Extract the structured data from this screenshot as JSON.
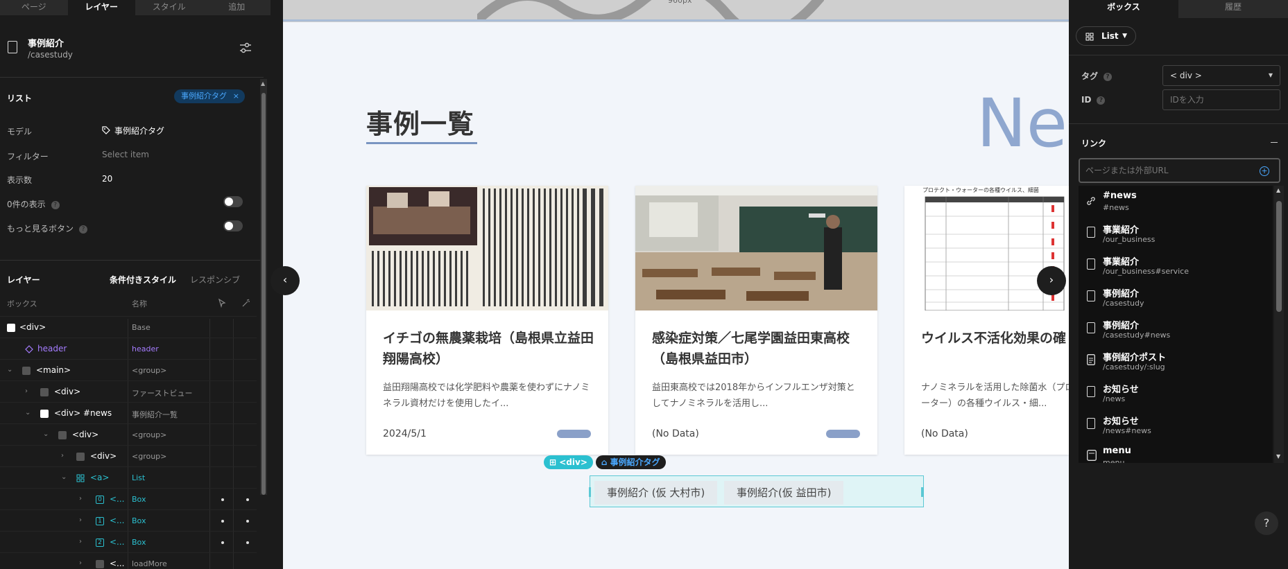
{
  "left": {
    "tabs": [
      "ページ",
      "レイヤー",
      "スタイル",
      "追加"
    ],
    "page": {
      "title": "事例紹介",
      "path": "/casestudy"
    },
    "list": {
      "title": "リスト",
      "chip": "事例紹介タグ",
      "props": {
        "model_label": "モデル",
        "model_value": "事例紹介タグ",
        "filter_label": "フィルター",
        "filter_value": "Select item",
        "count_label": "表示数",
        "count_value": "20",
        "zero_label": "0件の表示",
        "more_label": "もっと見るボタン"
      }
    },
    "layers": {
      "tabs": [
        "レイヤー",
        "条件付きスタイル",
        "レスポンシブ"
      ],
      "col_box": "ボックス",
      "col_name": "名称",
      "rows": [
        {
          "label": "<div>",
          "name": "Base"
        },
        {
          "label": "header",
          "name": "header"
        },
        {
          "label": "<main>",
          "name": "<group>"
        },
        {
          "label": "<div>",
          "name": "ファーストビュー"
        },
        {
          "label": "<div> #news",
          "name": "事例紹介一覧"
        },
        {
          "label": "<div>",
          "name": "<group>"
        },
        {
          "label": "<div>",
          "name": "<group>"
        },
        {
          "label": "<a>",
          "name": "List"
        },
        {
          "label": "<...",
          "name": "Box",
          "idx": "0"
        },
        {
          "label": "<...",
          "name": "Box",
          "idx": "1"
        },
        {
          "label": "<...",
          "name": "Box",
          "idx": "2"
        },
        {
          "label": "<...",
          "name": "loadMore"
        }
      ]
    }
  },
  "canvas": {
    "ruler_label": "960px",
    "section_title": "事例一覧",
    "big_word": "New",
    "cards": [
      {
        "title": "イチゴの無農薬栽培（島根県立益田翔陽高校）",
        "desc": "益田翔陽高校では化学肥料や農薬を使わずにナノミネラル資材だけを使用したイ...",
        "date": "2024/5/1"
      },
      {
        "title": "感染症対策／七尾学園益田東高校（島根県益田市）",
        "desc": "益田東高校では2018年からインフルエンザ対策としてナノミネラルを活用し...",
        "date": "(No Data)"
      },
      {
        "title": "ウイルス不活化効果の確",
        "desc": "ナノミネラルを活用した除菌水（プロ\nーター）の各種ウイルス・細...",
        "date": "(No Data)",
        "img_caption": "プロテクト・ウォーターの各種ウイルス、細菌"
      }
    ],
    "prev_arrow": "‹",
    "next_arrow": "›",
    "sel_tags": [
      "<div>",
      "事例紹介タグ"
    ],
    "sel_items": [
      "事例紹介 (仮 大村市)",
      "事例紹介(仮 益田市)"
    ]
  },
  "right": {
    "tabs": [
      "ボックス",
      "履歴"
    ],
    "list_button": "List",
    "tag_label": "タグ",
    "tag_value": "< div >",
    "id_label": "ID",
    "id_placeholder": "IDを入力",
    "link_title": "リンク",
    "url_placeholder": "ページまたは外部URL",
    "items": [
      {
        "title": "#news",
        "path": "#news",
        "icon": "link-icon"
      },
      {
        "title": "事業紹介",
        "path": "/our_business",
        "icon": "page-icon"
      },
      {
        "title": "事業紹介",
        "path": "/our_business#service",
        "icon": "page-icon"
      },
      {
        "title": "事例紹介",
        "path": "/casestudy",
        "icon": "page-icon"
      },
      {
        "title": "事例紹介",
        "path": "/casestudy#news",
        "icon": "page-icon"
      },
      {
        "title": "事例紹介ポスト",
        "path": "/casestudy/:slug",
        "icon": "doc-icon"
      },
      {
        "title": "お知らせ",
        "path": "/news",
        "icon": "page-icon"
      },
      {
        "title": "お知らせ",
        "path": "/news#news",
        "icon": "page-icon"
      },
      {
        "title": "menu",
        "path": "menu",
        "icon": "menu-icon"
      }
    ],
    "help": "?"
  },
  "colors": {
    "accent": "#4aa8ff",
    "selection": "#5bc8d4",
    "title_underline": "#7a95c1",
    "header_layer": "#a57cff"
  }
}
